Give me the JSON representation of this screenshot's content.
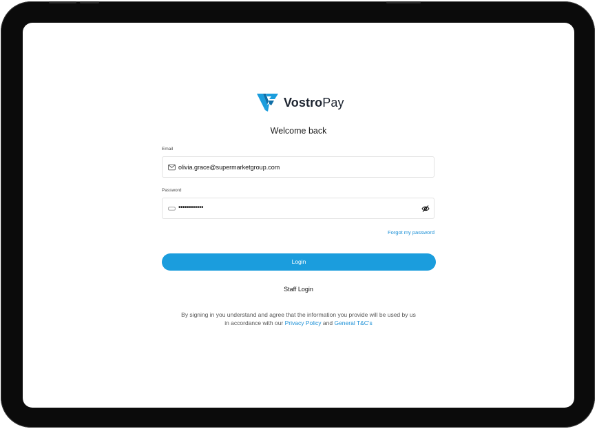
{
  "brand": {
    "name_bold": "Vostro",
    "name_light": "Pay"
  },
  "login": {
    "title": "Welcome back",
    "email_label": "Email",
    "email_value": "olivia.grace@supermarketgroup.com",
    "password_label": "Password",
    "password_value": "••••••••••••",
    "forgot_link": "Forgot my password",
    "login_button": "Login",
    "staff_login": "Staff Login",
    "terms_line1": "By signing in you understand and agree that the information you provide will be used by us",
    "terms_line2_prefix": "in accordance with our",
    "privacy_link": "Privacy Policy",
    "and_text": "and",
    "tc_link": "General T&C's"
  },
  "icons": {
    "logo": "vostropay-logo-icon",
    "email": "envelope-icon",
    "password": "key-icon",
    "visibility": "eye-slash-icon"
  },
  "colors": {
    "accent": "#1b9ddd",
    "link": "#1a8fd6",
    "brand_dark": "#1d2430",
    "device_frame": "#0b0b0b"
  }
}
